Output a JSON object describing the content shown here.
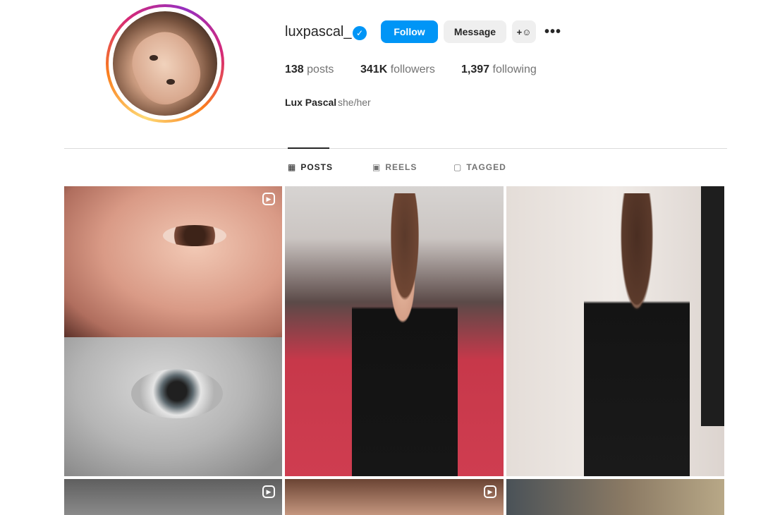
{
  "profile": {
    "username": "luxpascal_",
    "verified_icon": "verified-check-icon",
    "follow_label": "Follow",
    "message_label": "Message",
    "suggest_icon": "add-person-icon",
    "more_icon": "more-options-icon",
    "posts_count": "138",
    "posts_label": "posts",
    "followers_count": "341K",
    "followers_label": "followers",
    "following_count": "1,397",
    "following_label": "following",
    "full_name": "Lux Pascal",
    "pronouns": "she/her"
  },
  "tabs": [
    {
      "label": "POSTS",
      "icon": "grid-icon",
      "active": true
    },
    {
      "label": "REELS",
      "icon": "reels-icon",
      "active": false
    },
    {
      "label": "TAGGED",
      "icon": "tagged-icon",
      "active": false
    }
  ],
  "colors": {
    "accent": "#0095f6",
    "text": "#262626",
    "muted": "#737373",
    "button_gray": "#efefef"
  },
  "posts": [
    {
      "type": "reel"
    },
    {
      "type": "photo"
    },
    {
      "type": "photo"
    },
    {
      "type": "reel"
    },
    {
      "type": "reel"
    },
    {
      "type": "photo"
    }
  ]
}
